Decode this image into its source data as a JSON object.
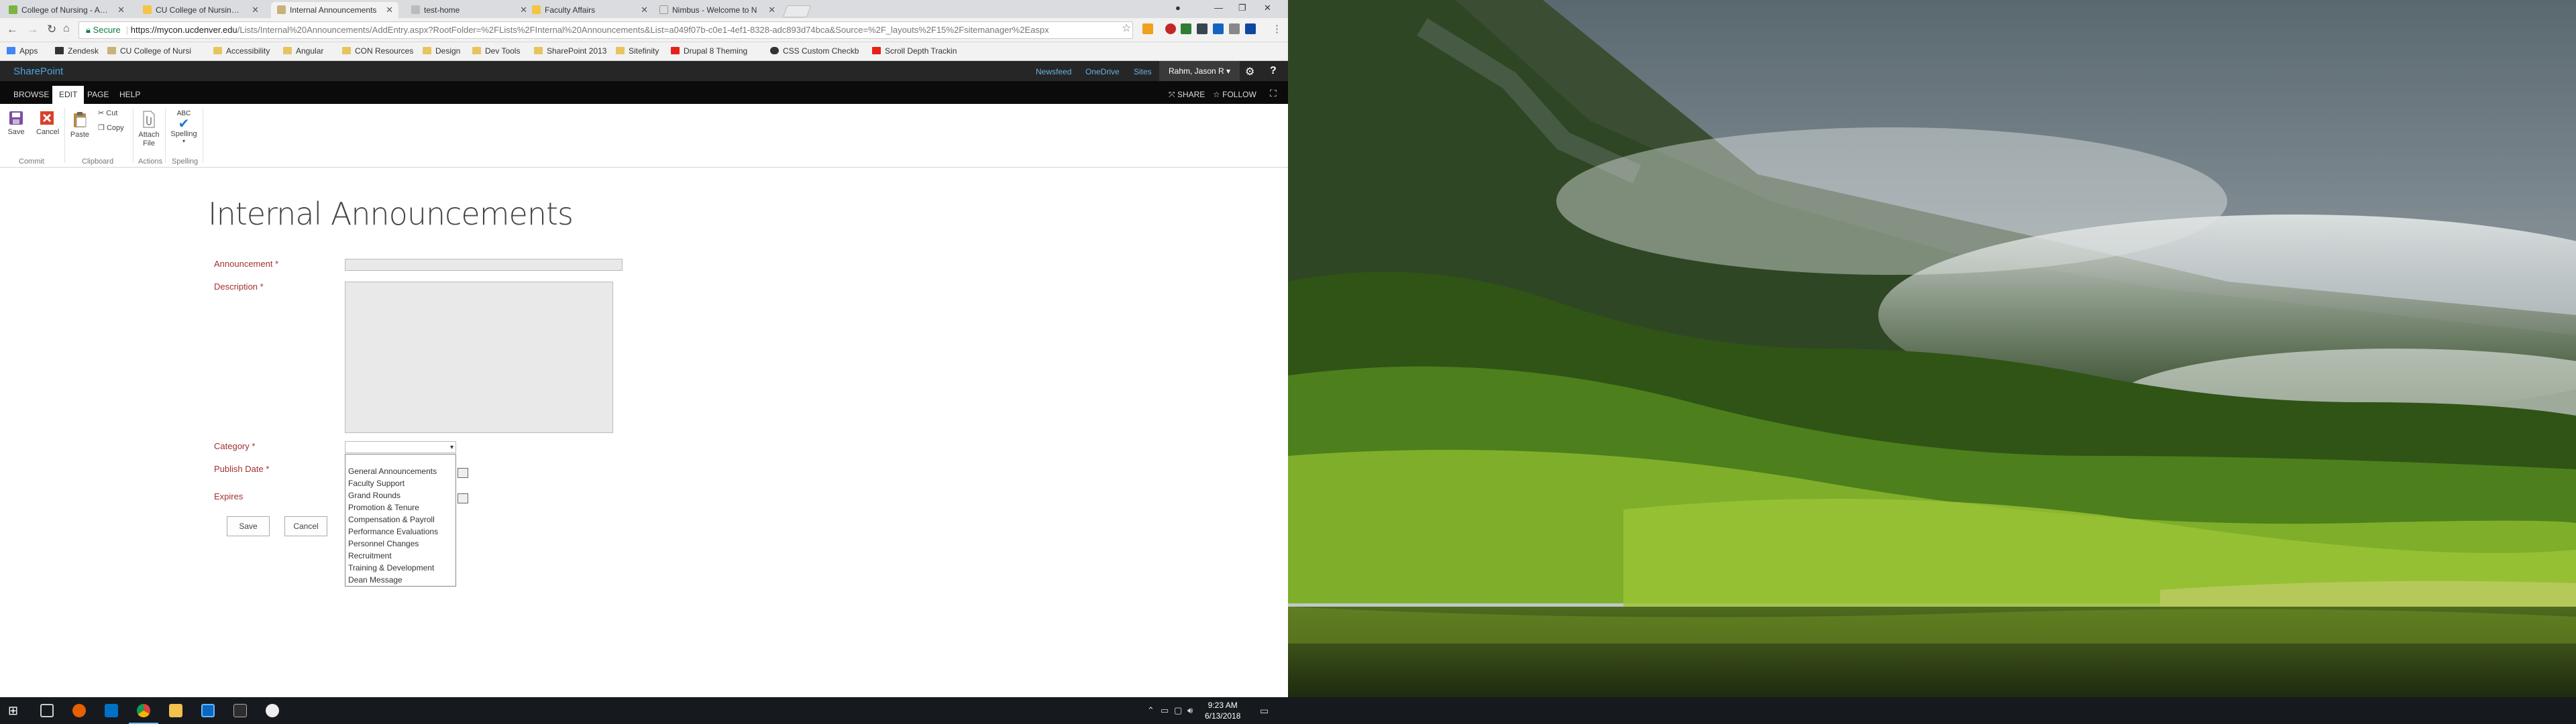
{
  "browser": {
    "tabs": [
      {
        "label": "College of Nursing - Age",
        "color": "#7cb342",
        "active": false
      },
      {
        "label": "CU College of Nursing In",
        "color": "#f4c542",
        "active": false
      },
      {
        "label": "Internal Announcements",
        "color": "#c7b27a",
        "active": true
      },
      {
        "label": "test-home",
        "color": "#bbbbbb",
        "active": false
      },
      {
        "label": "Faculty Affairs",
        "color": "#f4c542",
        "active": false
      },
      {
        "label": "Nimbus - Welcome to N",
        "color": "#dddddd",
        "active": false
      }
    ],
    "address": {
      "secure_label": "Secure",
      "host": "https://mycon.ucdenver.edu",
      "path": "/Lists/Internal%20Announcements/AddEntry.aspx?RootFolder=%2FLists%2FInternal%20Announcements&List=a049f07b-c0e1-4ef1-8328-adc893d74bca&Source=%2F_layouts%2F15%2Fsitemanager%2Easpx"
    },
    "bookmarks": [
      {
        "label": "Apps",
        "icon": "apps-grid-icon",
        "color": "#4285f4"
      },
      {
        "label": "Zendesk",
        "icon": "zendesk-icon",
        "color": "#333333"
      },
      {
        "label": "CU College of Nursi",
        "icon": "cu-logo-icon",
        "color": "#c7b27a"
      },
      {
        "label": "Accessibility",
        "icon": "folder-icon",
        "color": "#e8c45e"
      },
      {
        "label": "Angular",
        "icon": "folder-icon",
        "color": "#e8c45e"
      },
      {
        "label": "CON Resources",
        "icon": "folder-icon",
        "color": "#e8c45e"
      },
      {
        "label": "Design",
        "icon": "folder-icon",
        "color": "#e8c45e"
      },
      {
        "label": "Dev Tools",
        "icon": "folder-icon",
        "color": "#e8c45e"
      },
      {
        "label": "SharePoint 2013",
        "icon": "folder-icon",
        "color": "#e8c45e"
      },
      {
        "label": "Sitefinity",
        "icon": "folder-icon",
        "color": "#e8c45e"
      },
      {
        "label": "Drupal 8 Theming",
        "icon": "youtube-icon",
        "color": "#e62117"
      },
      {
        "label": "CSS Custom Checkb",
        "icon": "github-icon",
        "color": "#333333"
      },
      {
        "label": "Scroll Depth Trackin",
        "icon": "youtube-icon",
        "color": "#e62117"
      }
    ]
  },
  "sharepoint": {
    "brand": "SharePoint",
    "suite_links": [
      "Newsfeed",
      "OneDrive",
      "Sites"
    ],
    "user": "Rahm, Jason R",
    "ribbon_tabs": [
      "BROWSE",
      "EDIT",
      "PAGE",
      "HELP"
    ],
    "active_ribbon_tab": "EDIT",
    "share_label": "SHARE",
    "follow_label": "FOLLOW",
    "ribbon": {
      "save": "Save",
      "cancel": "Cancel",
      "paste": "Paste",
      "cut": "Cut",
      "copy": "Copy",
      "attach_file": "Attach File",
      "spelling_abc": "ABC",
      "spelling": "Spelling",
      "groups": {
        "commit": "Commit",
        "clipboard": "Clipboard",
        "actions": "Actions",
        "spelling": "Spelling"
      }
    }
  },
  "form": {
    "title": "Internal Announcements",
    "labels": {
      "announcement": "Announcement *",
      "description": "Description *",
      "category": "Category *",
      "publish_date": "Publish Date *",
      "expires": "Expires"
    },
    "category_value": "",
    "category_options": [
      "General Announcements",
      "Faculty Support",
      "Grand Rounds",
      "Promotion & Tenure",
      "Compensation & Payroll",
      "Performance Evaluations",
      "Personnel Changes",
      "Recruitment",
      "Training & Development",
      "Dean Message"
    ],
    "save": "Save",
    "cancel": "Cancel"
  },
  "taskbar": {
    "time": "9:23 AM",
    "date": "6/13/2018"
  }
}
